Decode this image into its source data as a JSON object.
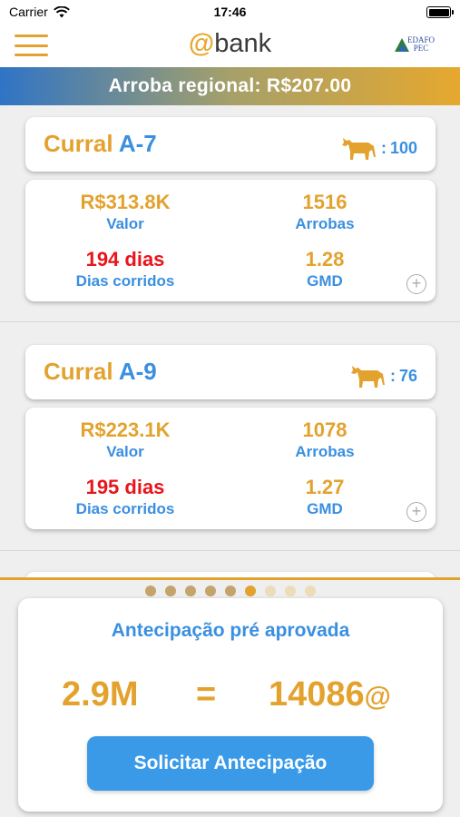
{
  "status_bar": {
    "carrier": "Carrier",
    "time": "17:46"
  },
  "header": {
    "logo_at": "@",
    "logo_text": "bank",
    "partner_line1": "EDAFO",
    "partner_line2": "PEC"
  },
  "banner": {
    "text": "Arroba regional: R$207.00"
  },
  "corrals": [
    {
      "name_prefix": "Curral",
      "name_id": "A-7",
      "cattle_count": "100",
      "valor": "R$313.8K",
      "valor_label": "Valor",
      "arrobas": "1516",
      "arrobas_label": "Arrobas",
      "dias": "194 dias",
      "dias_label": "Dias corridos",
      "gmd": "1.28",
      "gmd_label": "GMD"
    },
    {
      "name_prefix": "Curral",
      "name_id": "A-9",
      "cattle_count": "76",
      "valor": "R$223.1K",
      "valor_label": "Valor",
      "arrobas": "1078",
      "arrobas_label": "Arrobas",
      "dias": "195 dias",
      "dias_label": "Dias corridos",
      "gmd": "1.27",
      "gmd_label": "GMD"
    }
  ],
  "pager": {
    "count": 9,
    "active_index": 5
  },
  "anticipation": {
    "heading": "Antecipação pré aprovada",
    "amount": "2.9M",
    "equals": "=",
    "arrobas": "14086",
    "arroba_symbol": "@",
    "button_label": "Solicitar Antecipação"
  },
  "colors": {
    "gold": "#e3a22e",
    "blue": "#3a8fe0",
    "red": "#e8151b",
    "button": "#3a9ae8"
  },
  "icons": {
    "menu": "hamburger-menu-icon",
    "cattle": "cattle-icon",
    "add": "plus-circle-icon",
    "wifi": "wifi-icon",
    "battery": "battery-icon"
  }
}
